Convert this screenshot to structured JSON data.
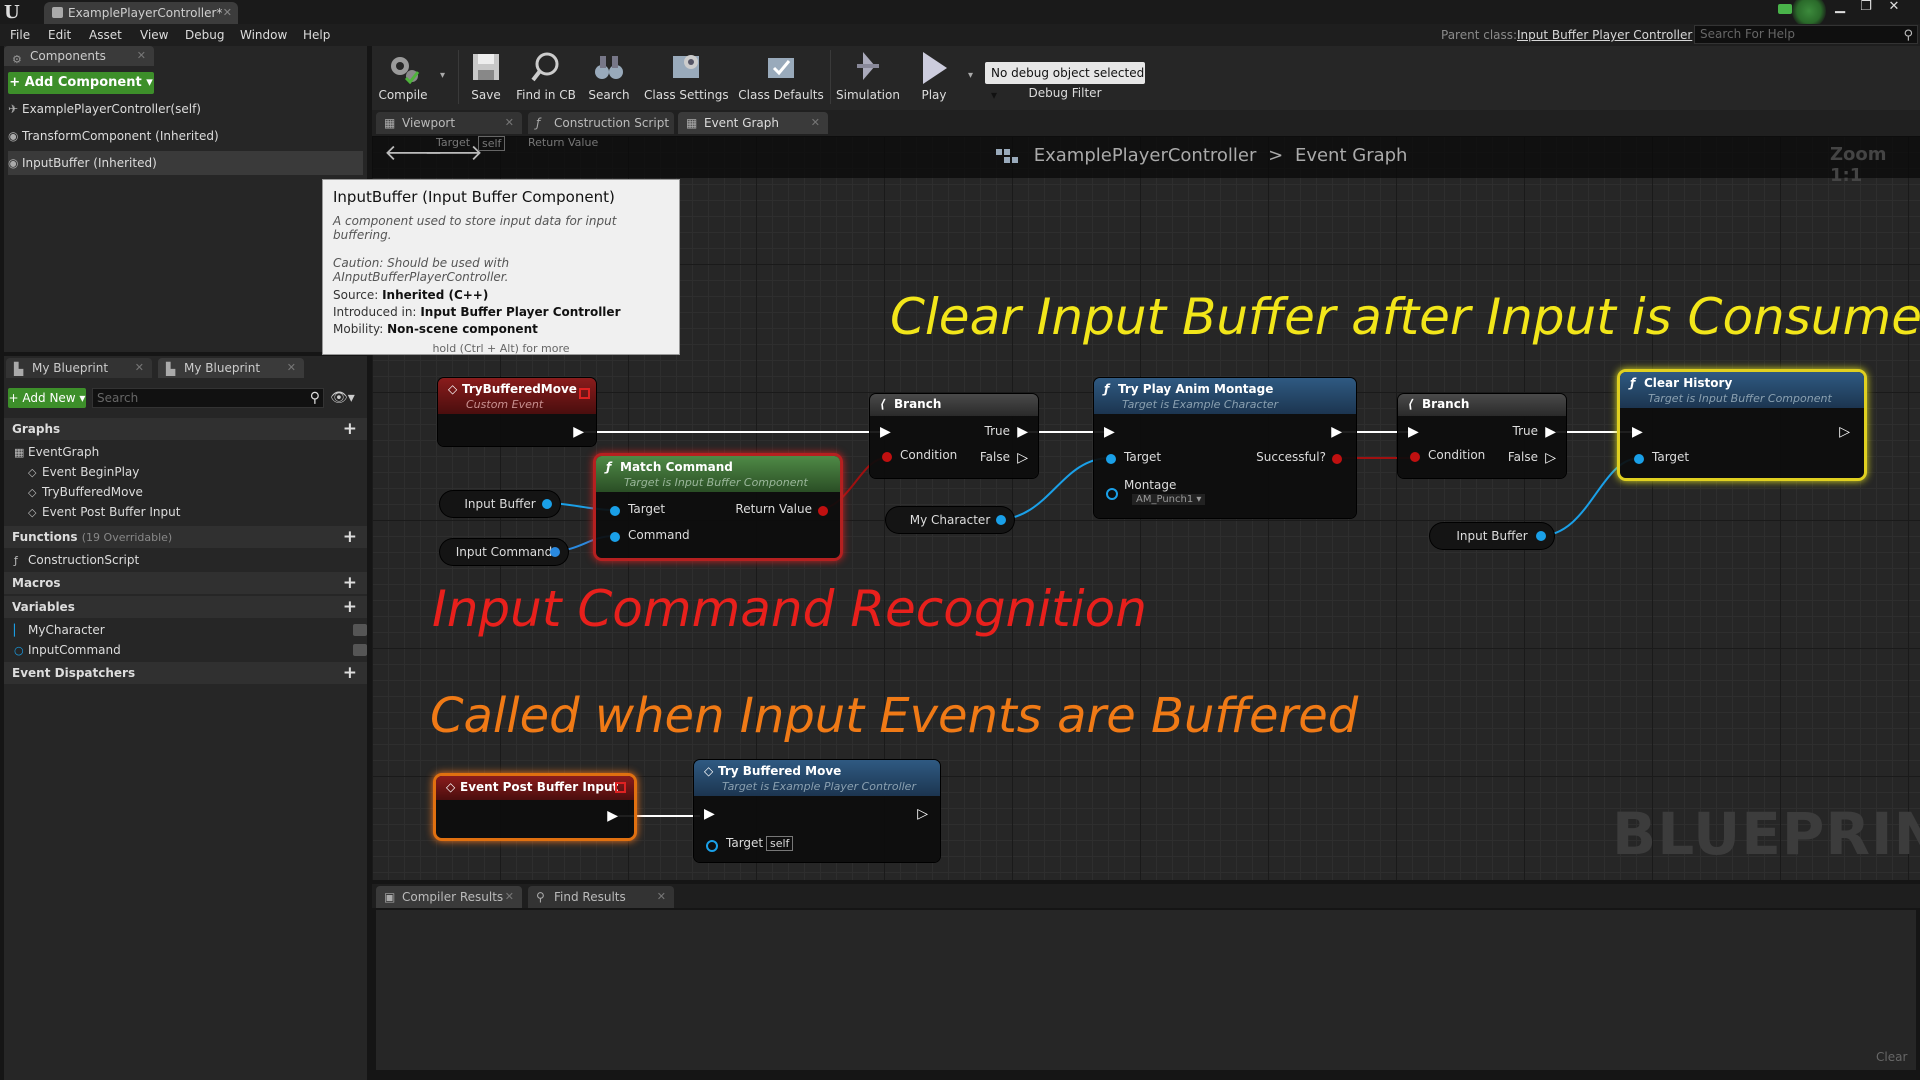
{
  "window": {
    "tab_title": "ExamplePlayerController*",
    "parent_class_label": "Parent class:",
    "parent_class_value": "Input Buffer Player Controller",
    "help_search_placeholder": "Search For Help"
  },
  "menu": [
    "File",
    "Edit",
    "Asset",
    "View",
    "Debug",
    "Window",
    "Help"
  ],
  "components": {
    "tab_label": "Components",
    "add_button": "+ Add Component ▾",
    "items": [
      "ExamplePlayerController(self)",
      "TransformComponent (Inherited)",
      "InputBuffer (Inherited)"
    ]
  },
  "tooltip": {
    "title": "InputBuffer (Input Buffer Component)",
    "description": "A component used to store input data for input buffering.",
    "caution": "Caution: Should be used with AInputBufferPlayerController.",
    "source_label": "Source:",
    "source_value": "Inherited (C++)",
    "introduced_label": "Introduced in:",
    "introduced_value": "Input Buffer Player Controller",
    "mobility_label": "Mobility:",
    "mobility_value": "Non-scene component",
    "hint": "hold (Ctrl + Alt) for more"
  },
  "my_blueprint": {
    "tabs": [
      "My Blueprint",
      "My Blueprint"
    ],
    "add_new": "+ Add New ▾",
    "search_placeholder": "Search",
    "graphs_header": "Graphs",
    "graphs": [
      "EventGraph",
      "Event BeginPlay",
      "TryBufferedMove",
      "Event Post Buffer Input"
    ],
    "functions_header": "Functions",
    "functions_sub": "(19 Overridable)",
    "functions": [
      "ConstructionScript"
    ],
    "macros_header": "Macros",
    "variables_header": "Variables",
    "variables": [
      "MyCharacter",
      "InputCommand"
    ],
    "dispatchers_header": "Event Dispatchers"
  },
  "toolbar": {
    "buttons": [
      "Compile",
      "Save",
      "Find in CB",
      "Search",
      "Class Settings",
      "Class Defaults",
      "Simulation",
      "Play"
    ],
    "debug_object": "No debug object selected ▾",
    "debug_filter": "Debug Filter"
  },
  "graph_tabs": [
    "Viewport",
    "Construction Script",
    "Event Graph"
  ],
  "graph": {
    "breadcrumb_root": "ExamplePlayerController",
    "breadcrumb_sep": ">",
    "breadcrumb_leaf": "Event Graph",
    "zoom": "Zoom 1:1",
    "watermark": "BLUEPRINT",
    "ghost_target": "Target",
    "ghost_self": "self",
    "ghost_return": "Return Value"
  },
  "annotations": {
    "top": "Clear Input Buffer after Input is Consumed",
    "middle": "Input Command Recognition",
    "bottom": "Called when Input Events are Buffered",
    "colors": {
      "top": "#f2e61a",
      "middle": "#e8201c",
      "bottom": "#f07a16"
    }
  },
  "nodes": {
    "try_buffered_move_event": {
      "title": "TryBufferedMove",
      "subtitle": "Custom Event"
    },
    "match_command": {
      "title": "Match Command",
      "subtitle": "Target is Input Buffer Component",
      "pin_target": "Target",
      "pin_command": "Command",
      "pin_return": "Return Value"
    },
    "branch_1": {
      "title": "Branch",
      "pin_true": "True",
      "pin_condition": "Condition",
      "pin_false": "False"
    },
    "play_montage": {
      "title": "Try Play Anim Montage",
      "subtitle": "Target is Example Character",
      "pin_target": "Target",
      "pin_success": "Successful?",
      "pin_montage": "Montage",
      "montage_value": "AM_Punch1 ▾"
    },
    "branch_2": {
      "title": "Branch",
      "pin_true": "True",
      "pin_condition": "Condition",
      "pin_false": "False"
    },
    "clear_history": {
      "title": "Clear History",
      "subtitle": "Target is Input Buffer Component",
      "pin_target": "Target"
    },
    "post_buffer_event": {
      "title": "Event Post Buffer Input"
    },
    "try_buffered_move_call": {
      "title": "Try Buffered Move",
      "subtitle": "Target is Example Player Controller",
      "pin_target": "Target",
      "self_value": "self"
    },
    "var_input_buffer_1": "Input Buffer",
    "var_input_command": "Input Command",
    "var_my_character": "My Character",
    "var_input_buffer_2": "Input Buffer"
  },
  "bottom_tabs": [
    "Compiler Results",
    "Find Results"
  ],
  "bottom_clear": "Clear",
  "colors": {
    "event_header": "#7a1a1a",
    "function_header": "#2a4a6a",
    "pure_function_header": "#3f6a3a",
    "exec_wire": "#ffffff",
    "object_pin": "#1aa0e8",
    "bool_pin": "#a01010"
  }
}
